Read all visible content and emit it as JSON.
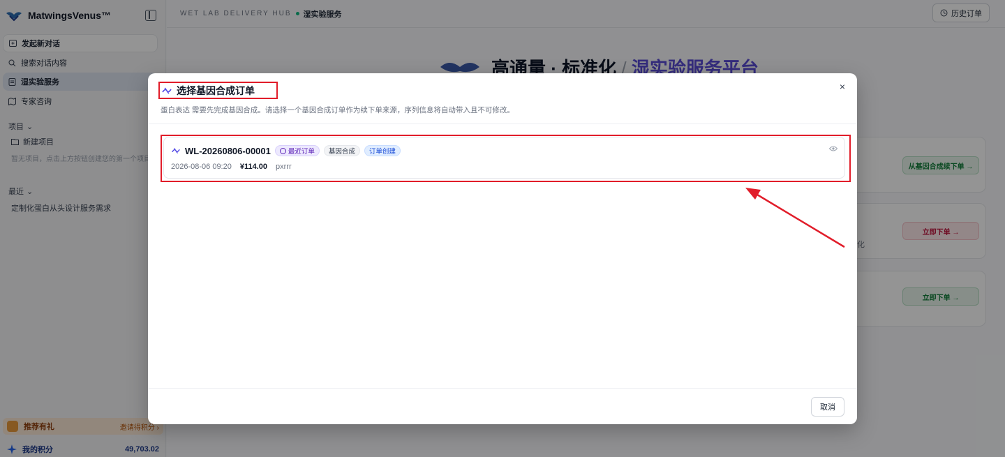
{
  "sidebar": {
    "brand": "MatwingsVenus™",
    "nav": {
      "new_chat": "发起新对话",
      "search": "搜索对话内容",
      "wetlab": "湿实验服务",
      "expert": "专家咨询"
    },
    "projects_header": "项目",
    "new_project": "新建项目",
    "projects_empty": "暂无项目，点击上方按钮创建您的第一个项目",
    "recent_header": "最近",
    "recent_items": [
      "定制化蛋白从头设计服务需求"
    ],
    "referral": {
      "title": "推荐有礼",
      "link": "邀请得积分 ›"
    },
    "points": {
      "label": "我的积分",
      "value": "49,703.02"
    }
  },
  "topbar": {
    "hub": "WET LAB DELIVERY HUB",
    "crumb": "湿实验服务",
    "history_button": "历史订单"
  },
  "hero": {
    "part1": "高通量 · 标准化",
    "slash": "/",
    "part2": "湿实验服务平台"
  },
  "cards": {
    "btn1": "从基因合成续下单 →",
    "btn2": "立即下单 →",
    "btn3": "立即下单 →",
    "tail": "化"
  },
  "modal": {
    "title": "选择基因合成订单",
    "description": "蛋白表达 需要先完成基因合成。请选择一个基因合成订单作为续下单来源，序列信息将自动带入且不可修改。",
    "orders": [
      {
        "id": "WL-20260806-00001",
        "tags": {
          "recent": "最近订单",
          "type": "基因合成",
          "status": "订单创建"
        },
        "date": "2026-08-06 09:20",
        "price": "¥114.00",
        "user": "pxrrr"
      }
    ],
    "cancel": "取消"
  },
  "colors": {
    "accent": "#5b4cd6",
    "highlight": "#e11d2a",
    "brand_navy": "#1e3a8a"
  }
}
